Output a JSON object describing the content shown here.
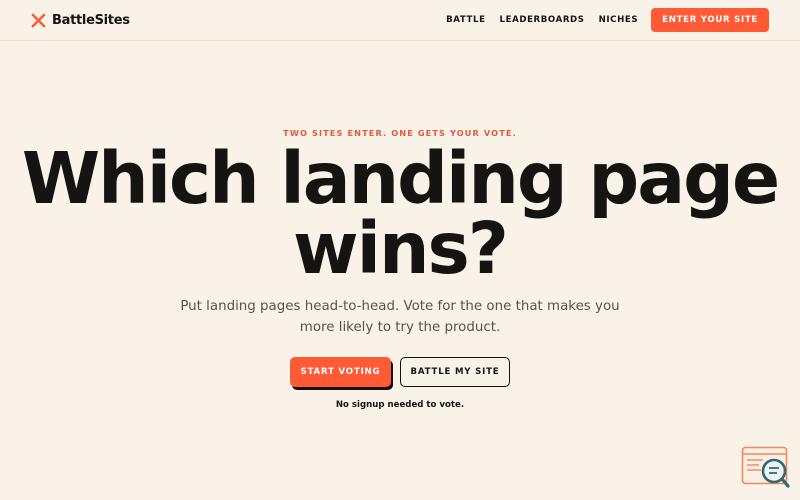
{
  "nav": {
    "brand": "BattleSites",
    "links": [
      "BATTLE",
      "LEADERBOARDS",
      "NICHES"
    ],
    "cta": "ENTER YOUR SITE"
  },
  "hero": {
    "eyebrow": "TWO SITES ENTER. ONE GETS YOUR VOTE.",
    "headline_line1": "Which landing page",
    "headline_line2": "wins?",
    "subtext_line1": "Put landing pages head-to-head. Vote for the one that makes you",
    "subtext_line2": "more likely to try the product.",
    "primary_button": "START VOTING",
    "secondary_button": "BATTLE MY SITE",
    "note": "No signup needed to vote."
  },
  "colors": {
    "background": "#f8f2e8",
    "accent": "#ff5a36",
    "text": "#161412",
    "widget": "#2f6b73"
  },
  "icons": {
    "brand": "crossed-swords-icon",
    "widget": "search-feedback-icon"
  }
}
